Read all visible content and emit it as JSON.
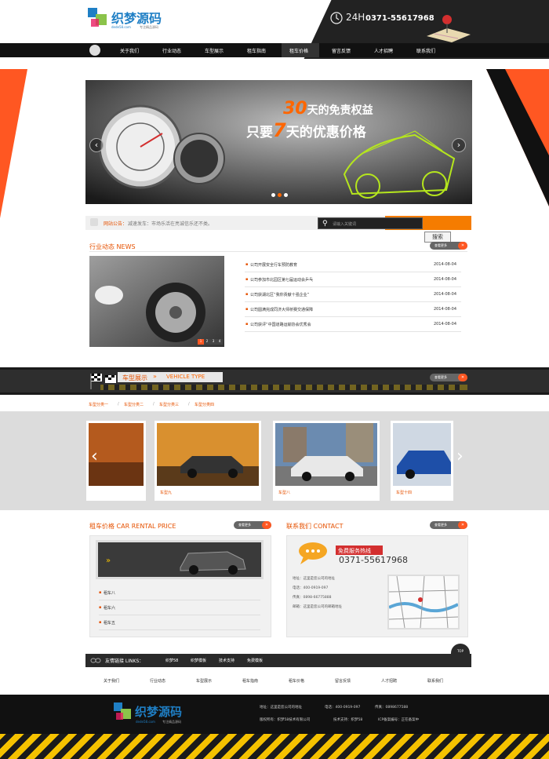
{
  "header": {
    "logo_text": "织梦源码",
    "logo_domain": "dede58.com",
    "logo_slogan": "专注精品源码",
    "hours": "24H",
    "phone": "0371-55617968"
  },
  "nav": {
    "items": [
      "关于我们",
      "行业动态",
      "车型展示",
      "租车指南",
      "租车价格",
      "留言反馈",
      "人才招聘",
      "联系我们"
    ],
    "active_index": 4
  },
  "banner": {
    "days_big": "30",
    "line1_suffix": "天的免责权益",
    "line2_prefix": "只要",
    "days_small": "7",
    "line2_suffix": "天的优惠价格",
    "prev": "‹",
    "next": "›"
  },
  "notice": {
    "label": "网站公告：",
    "text": "减速发车：市场乐活在亮诚信乐还不类。"
  },
  "search": {
    "placeholder": "请输入关键词",
    "button": "搜索"
  },
  "news": {
    "title": "行业动态  NEWS",
    "more": "查看更多",
    "pager": [
      "1",
      "2",
      "3",
      "4"
    ],
    "items": [
      {
        "title": "公司开展安全行车预防教育",
        "date": "2014-08-04"
      },
      {
        "title": "公司参加市北园区第七届运动会乒乓",
        "date": "2014-08-04"
      },
      {
        "title": "公司获湖北区“我你贡献十强企业”",
        "date": "2014-08-04"
      },
      {
        "title": "公司圆满完成同济大师桥赛交通保障",
        "date": "2014-08-04"
      },
      {
        "title": "公司获评“中国道路运输协会优秀会",
        "date": "2014-08-04"
      }
    ]
  },
  "vehicle": {
    "title": "车型展示",
    "title_en": "VEHICLE TYPE",
    "more": "查看更多",
    "categories": [
      "车型分类一",
      "车型分类二",
      "车型分类三",
      "车型分类四"
    ],
    "cards": [
      {
        "name": "车型九"
      },
      {
        "name": "车型八"
      },
      {
        "name": "车型十四"
      }
    ],
    "prev": "‹",
    "next": "›"
  },
  "rent": {
    "title": "租车价格  CAR RENTAL PRICE",
    "more": "查看更多",
    "items": [
      "租车八",
      "租车六",
      "租车五"
    ]
  },
  "contact": {
    "title": "联系我们  CONTACT",
    "more": "查看更多",
    "hotline_label": "免费服务热线",
    "hotline": "0371-55617968",
    "lines": [
      "地址：这里是您公司的地址",
      "电话：400-0919-097",
      "传真：0898-66775888",
      "邮箱：这里是您公司的邮箱地址"
    ]
  },
  "links": {
    "label": "友情链接 LINKS：",
    "items": [
      "织梦58",
      "织梦模板",
      "技术支持",
      "免费模板"
    ],
    "top": "TOP"
  },
  "bottom_nav": [
    "关于我们",
    "行业动态",
    "车型展示",
    "租车指南",
    "租车价格",
    "留言反馈",
    "人才招聘",
    "联系我们"
  ],
  "footer": {
    "address": "地址：这里是您公司的地址",
    "phone": "电话：400-0919-097",
    "fax": "传真：0898677588",
    "copyright": "版权所有：织梦58技术有限公司",
    "support": "技术支持：织梦58",
    "icp": "ICP备案编号：正在备案中"
  },
  "colors": {
    "accent": "#ff6600",
    "dark": "#222222"
  }
}
